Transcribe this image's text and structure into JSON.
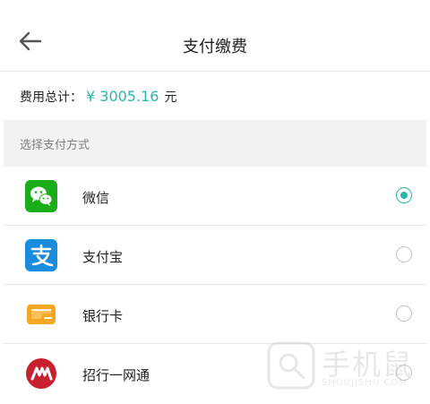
{
  "header": {
    "title": "支付缴费"
  },
  "total": {
    "label": "费用总计：",
    "amount": "¥ 3005.16",
    "unit": "元"
  },
  "section": {
    "label": "选择支付方式"
  },
  "payment_methods": [
    {
      "label": "微信",
      "icon": "wechat-icon",
      "selected": true,
      "color": "#1aad19"
    },
    {
      "label": "支付宝",
      "icon": "alipay-icon",
      "selected": false,
      "color": "#1a8cde"
    },
    {
      "label": "银行卡",
      "icon": "bank-card-icon",
      "selected": false,
      "color": "#f5a623"
    },
    {
      "label": "招行一网通",
      "icon": "cmb-icon",
      "selected": false,
      "color": "#c8202f"
    }
  ],
  "watermark": {
    "text": "手机鼠",
    "sub": "SHOUJISHU.COM"
  },
  "colors": {
    "accent": "#28b8a8"
  }
}
